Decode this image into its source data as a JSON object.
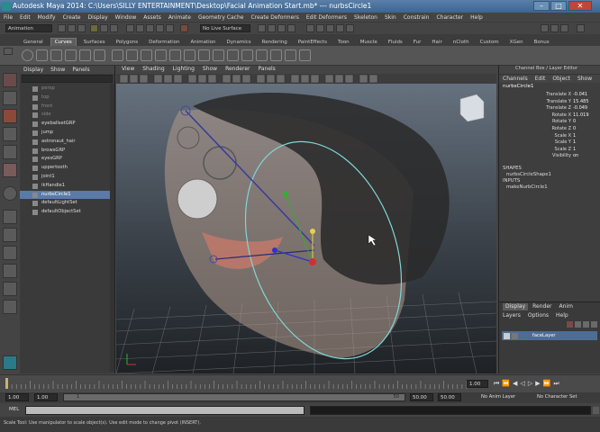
{
  "title": "Autodesk Maya 2014: C:\\Users\\SILLY ENTERTAINMENT\\Desktop\\Facial Animation Start.mb* --- nurbsCircle1",
  "menu": [
    "File",
    "Edit",
    "Modify",
    "Create",
    "Display",
    "Window",
    "Assets",
    "Animate",
    "Geometry Cache",
    "Create Deformers",
    "Edit Deformers",
    "Skeleton",
    "Skin",
    "Constrain",
    "Character",
    "Help"
  ],
  "status": {
    "mode": "Animation",
    "live_surface": "No Live Surface"
  },
  "shelf_tabs": [
    "General",
    "Curves",
    "Surfaces",
    "Polygons",
    "Deformation",
    "Animation",
    "Dynamics",
    "Rendering",
    "PaintEffects",
    "Toon",
    "Muscle",
    "Fluids",
    "Fur",
    "Hair",
    "nCloth",
    "Custom",
    "XGen",
    "Bonus"
  ],
  "shelf_active": "Curves",
  "outliner": {
    "menu": [
      "Display",
      "Show",
      "Panels"
    ],
    "items": [
      {
        "label": "persp",
        "dim": true
      },
      {
        "label": "top",
        "dim": true
      },
      {
        "label": "front",
        "dim": true
      },
      {
        "label": "side",
        "dim": true
      },
      {
        "label": "eyeballsetGRP",
        "dim": false
      },
      {
        "label": "jump",
        "dim": false
      },
      {
        "label": "astronaut_hair",
        "dim": false
      },
      {
        "label": "browsGRP",
        "dim": false
      },
      {
        "label": "eyesGRP",
        "dim": false
      },
      {
        "label": "uppertooth",
        "dim": false
      },
      {
        "label": "joint1",
        "dim": false
      },
      {
        "label": "ikHandle1",
        "dim": false
      },
      {
        "label": "nurbsCircle1",
        "dim": false,
        "selected": true
      },
      {
        "label": "defaultLightSet",
        "dim": false
      },
      {
        "label": "defaultObjectSet",
        "dim": false
      }
    ]
  },
  "viewport": {
    "menu": [
      "View",
      "Shading",
      "Lighting",
      "Show",
      "Renderer",
      "Panels"
    ]
  },
  "channel_box": {
    "header": "Channel Box / Layer Editor",
    "menu": [
      "Channels",
      "Edit",
      "Object",
      "Show"
    ],
    "object": "nurbsCircle1",
    "attributes": [
      {
        "name": "Translate X",
        "value": "-0.041"
      },
      {
        "name": "Translate Y",
        "value": "15.485"
      },
      {
        "name": "Translate Z",
        "value": "-0.049"
      },
      {
        "name": "Rotate X",
        "value": "11.019"
      },
      {
        "name": "Rotate Y",
        "value": "0"
      },
      {
        "name": "Rotate Z",
        "value": "0"
      },
      {
        "name": "Scale X",
        "value": "1"
      },
      {
        "name": "Scale Y",
        "value": "1"
      },
      {
        "name": "Scale Z",
        "value": "1"
      },
      {
        "name": "Visibility",
        "value": "on"
      }
    ],
    "shapes_label": "SHAPES",
    "shape": "nurbsCircleShape1",
    "inputs_label": "INPUTS",
    "input": "makeNurbCircle1",
    "layer_tabs": [
      "Display",
      "Render",
      "Anim"
    ],
    "layer_menu": [
      "Layers",
      "Options",
      "Help"
    ],
    "layer": "faceLayer"
  },
  "timeline": {
    "current": "1.00",
    "start": "1.00",
    "range_start": "1.00",
    "range_mid": "1",
    "range_end": "50",
    "range_end_field": "50.00",
    "end": "50.00",
    "anim_layer": "No Anim Layer",
    "character_set": "No Character Set"
  },
  "cmd": {
    "label": "MEL"
  },
  "help_text": "Scale Tool: Use manipulator to scale object(s). Use edit mode to change pivot (INSERT).",
  "colors": {
    "selection": "#5a7aa8",
    "manip_red": "#d03030",
    "manip_green": "#30b030",
    "manip_blue": "#3030d0",
    "manip_yellow": "#e6d24a",
    "circle_cyan": "#7fd6d6"
  }
}
